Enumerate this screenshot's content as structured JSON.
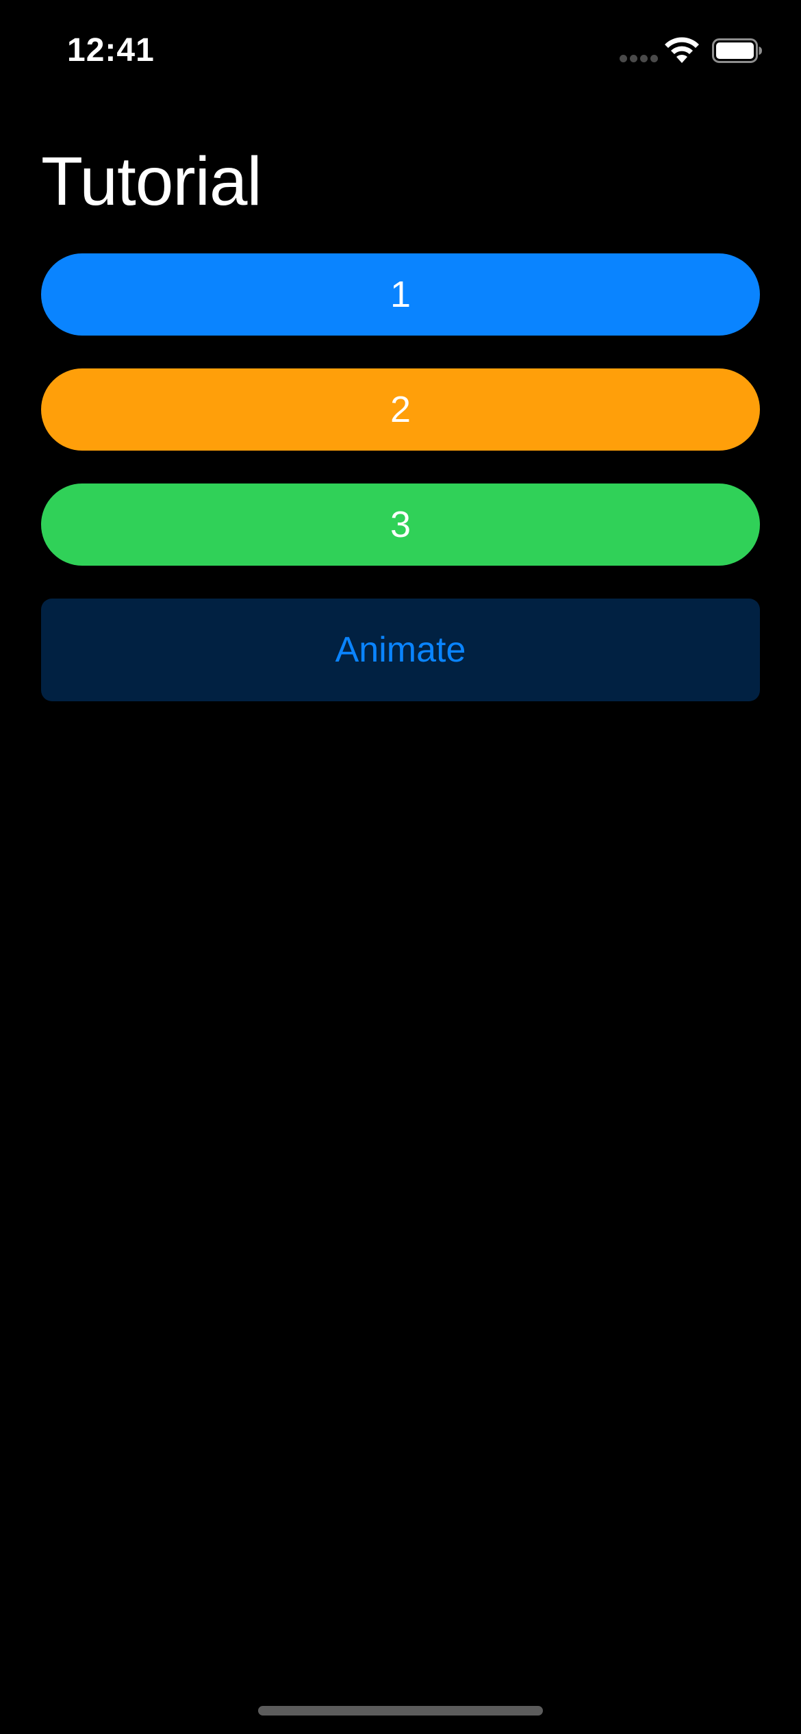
{
  "status_bar": {
    "time": "12:41",
    "signal_icon": "cellular-signal-icon",
    "wifi_icon": "wifi-icon",
    "battery_icon": "battery-icon",
    "battery_level": 1.0
  },
  "page": {
    "title": "Tutorial"
  },
  "buttons": [
    {
      "label": "1",
      "color": "#0a84ff"
    },
    {
      "label": "2",
      "color": "#ff9f0a"
    },
    {
      "label": "3",
      "color": "#30d158"
    }
  ],
  "animate_button": {
    "label": "Animate",
    "text_color": "#0a84ff",
    "background": "#012142"
  },
  "colors": {
    "background": "#000000",
    "text": "#ffffff"
  }
}
